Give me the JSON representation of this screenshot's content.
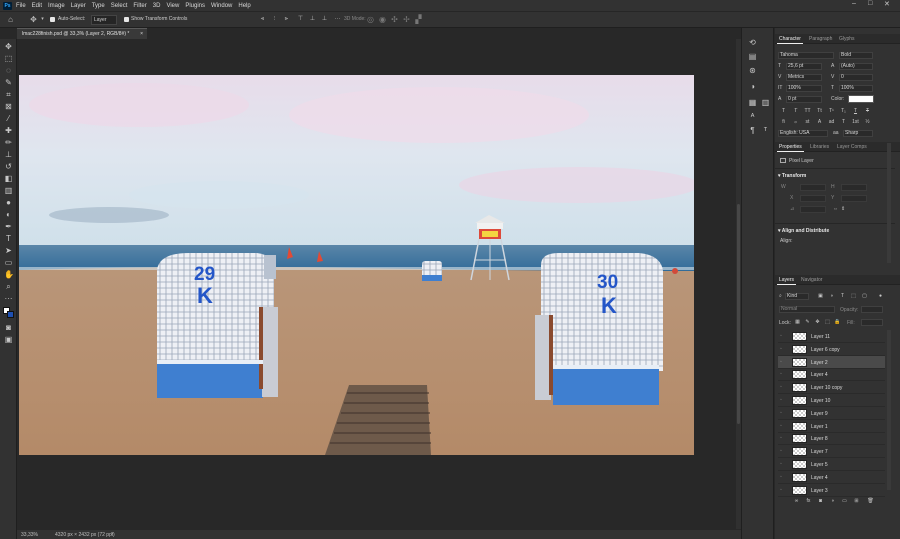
{
  "menubar": {
    "logo": "Ps",
    "items": [
      "File",
      "Edit",
      "Image",
      "Layer",
      "Type",
      "Select",
      "Filter",
      "3D",
      "View",
      "Plugins",
      "Window",
      "Help"
    ],
    "minimize": "–",
    "maximize": "□",
    "close": "✕"
  },
  "options": {
    "auto_select_label": "Auto-Select:",
    "auto_select_value": "Layer",
    "show_transform_label": "Show Transform Controls",
    "mode_3d_label": "3D Mode:"
  },
  "document_tab": {
    "title": "lmac228finish.psd @ 33,3% (Layer 2, RGB/8#) *",
    "close": "×"
  },
  "photo": {
    "chair_left_number": "29",
    "chair_left_letter": "K",
    "chair_right_number": "30",
    "chair_right_letter": "K"
  },
  "status": {
    "zoom": "33,33%",
    "doc_info": "4320 px × 2432 px (72 ppi)",
    "arrow": "›"
  },
  "character_panel": {
    "tabs": [
      "Character",
      "Paragraph",
      "Glyphs"
    ],
    "font_family": "Tahoma",
    "font_style": "Bold",
    "font_size": "25,6 pt",
    "leading": "(Auto)",
    "kerning": "Metrics",
    "tracking": "0",
    "vertical_scale": "100%",
    "horizontal_scale": "100%",
    "baseline_shift": "0 pt",
    "color_label": "Color:",
    "type_style_buttons": [
      "T",
      "T",
      "TT",
      "Tt",
      "T¹",
      "T₁",
      "T",
      "T"
    ],
    "opentype_buttons": [
      "fi",
      "ℴ",
      "st",
      "A",
      "ad",
      "T",
      "1st",
      "½"
    ],
    "language": "English: USA",
    "anti_alias_icon": "aa",
    "anti_alias": "Sharp"
  },
  "properties_panel": {
    "tabs": [
      "Properties",
      "Libraries",
      "Layer Comps"
    ],
    "layer_type": "Pixel Layer",
    "transform_title": "Transform",
    "w_label": "W",
    "h_label": "H",
    "x_label": "X",
    "y_label": "Y",
    "angle_label": "⊿",
    "align_title": "Align and Distribute",
    "align_label": "Align:"
  },
  "layers_panel": {
    "tabs": [
      "Layers",
      "Navigator"
    ],
    "filter_kind": "Kind",
    "blend_mode": "Normal",
    "opacity_label": "Opacity:",
    "lock_label": "Lock:",
    "fill_label": "Fill:",
    "layers": [
      "Layer 11",
      "Layer 6 copy",
      "Layer 2",
      "Layer 4",
      "Layer 10 copy",
      "Layer 10",
      "Layer 9",
      "Layer 1",
      "Layer 8",
      "Layer 7",
      "Layer 5",
      "Layer 4",
      "Layer 3"
    ],
    "selected_index": 2,
    "footer_buttons": [
      "link",
      "fx",
      "mask",
      "adjustment",
      "group",
      "new-layer",
      "delete"
    ]
  },
  "colors": {
    "ui_bg": "#323232",
    "canvas_bg": "#282828",
    "sky": "#dfe4f0",
    "sea": "#3b6e9a",
    "sand": "#b48c6a",
    "chair_blue": "#3f7fd0"
  }
}
